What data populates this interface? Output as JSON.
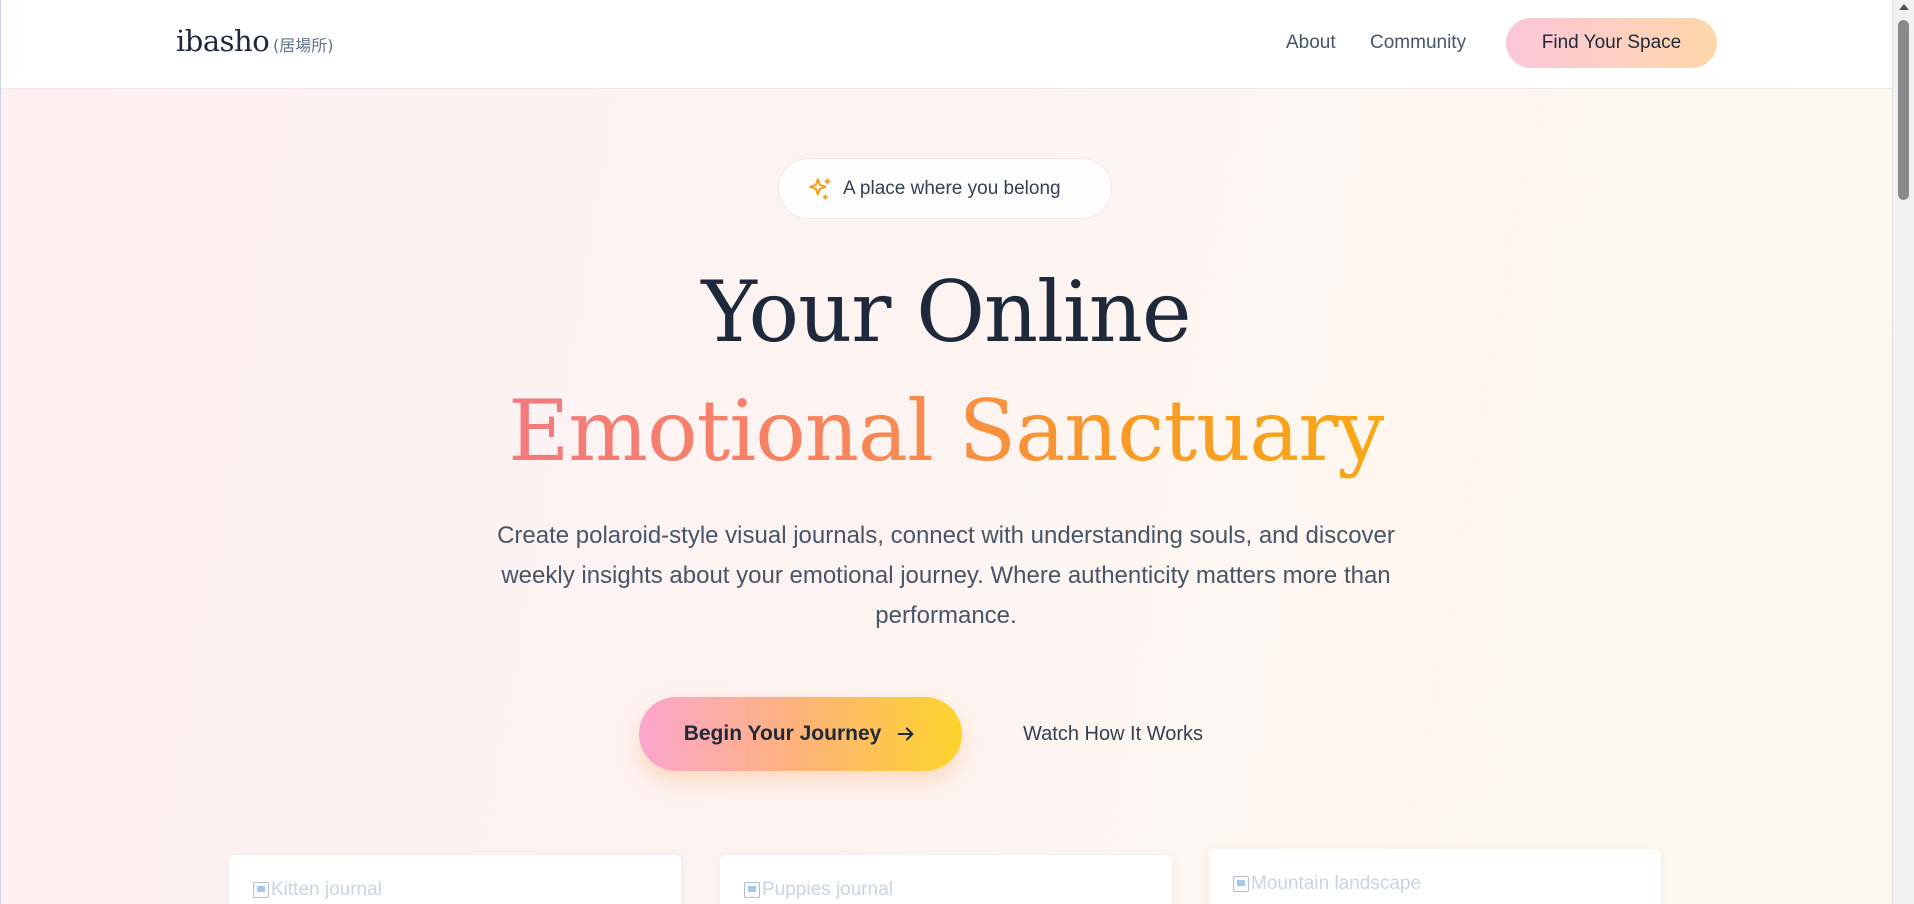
{
  "header": {
    "logo": "ibasho",
    "logo_subtitle": "(居場所)",
    "nav": {
      "about": "About",
      "community": "Community",
      "cta": "Find Your Space"
    }
  },
  "hero": {
    "badge_icon": "sparkles-icon",
    "badge_text": "A place where you belong",
    "headline_line1": "Your Online",
    "headline_line2": "Emotional Sanctuary",
    "description": "Create polaroid-style visual journals, connect with understanding souls, and discover weekly insights about your emotional journey. Where authenticity matters more than performance.",
    "primary_cta": "Begin Your Journey",
    "primary_cta_icon": "arrow-right-icon",
    "secondary_cta": "Watch How It Works"
  },
  "cards": [
    {
      "alt": "Kitten journal"
    },
    {
      "alt": "Puppies journal"
    },
    {
      "alt": "Mountain landscape"
    }
  ],
  "colors": {
    "heading": "#1e293b",
    "accent_start": "#f47a7f",
    "accent_end": "#f8a815",
    "cta_gradient_start": "#fba5cd",
    "cta_gradient_end": "#fdd42c"
  }
}
